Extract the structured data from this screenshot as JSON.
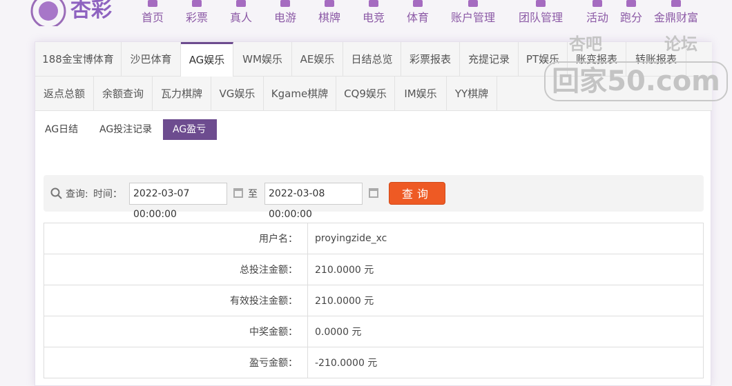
{
  "nav": {
    "logo": "杏彩",
    "items": [
      "首页",
      "彩票",
      "真人",
      "电游",
      "棋牌",
      "电竞",
      "体育",
      "账户管理",
      "团队管理",
      "活动",
      "跑分",
      "金鼎财富"
    ]
  },
  "tabs_row1": [
    "188金宝博体育",
    "沙巴体育",
    "AG娱乐",
    "WM娱乐",
    "AE娱乐",
    "日结总览",
    "彩票报表",
    "充提记录",
    "PT娱乐",
    "账变报表",
    "转账报表"
  ],
  "tabs_row2": [
    "返点总额",
    "余额查询",
    "瓦力棋牌",
    "VG娱乐",
    "Kgame棋牌",
    "CQ9娱乐",
    "IM娱乐",
    "YY棋牌"
  ],
  "subtabs": [
    "AG日结",
    "AG投注记录",
    "AG盈亏"
  ],
  "search": {
    "query_label": "查询:",
    "time_label": "时间：",
    "start": "2022-03-07 00:00:00",
    "to": "至",
    "end": "2022-03-08 00:00:00",
    "button": "查询"
  },
  "rows": [
    {
      "label": "用户名：",
      "value": "proyingzide_xc"
    },
    {
      "label": "总投注金额：",
      "value": "210.0000 元"
    },
    {
      "label": "有效投注金额：",
      "value": "210.0000 元"
    },
    {
      "label": "中奖金额：",
      "value": "0.0000 元"
    },
    {
      "label": "盈亏金额：",
      "value": "-210.0000 元"
    }
  ],
  "watermark": {
    "line1a": "杏吧",
    "line1b": "论坛",
    "main": "回家50.com"
  }
}
